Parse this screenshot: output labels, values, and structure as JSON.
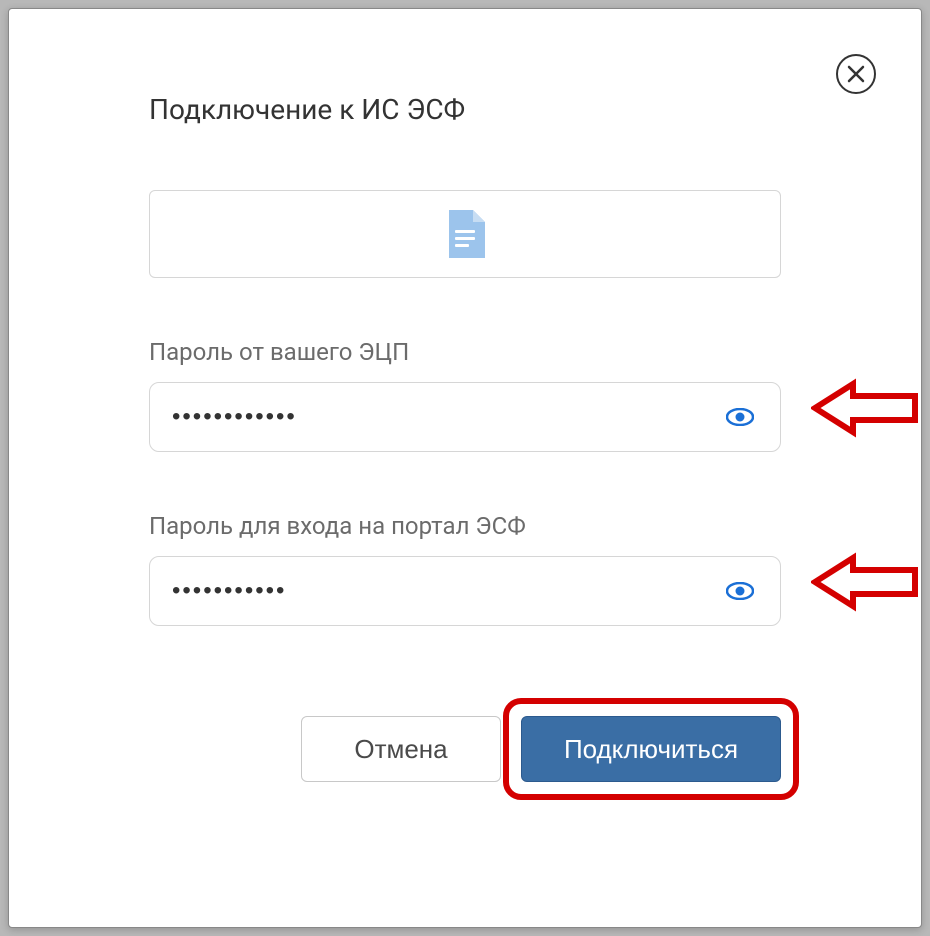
{
  "dialog": {
    "title": "Подключение к ИС ЭСФ",
    "file_icon": "document-icon"
  },
  "fields": {
    "ecp_password": {
      "label": "Пароль от вашего ЭЦП",
      "value": "••••••••••••"
    },
    "portal_password": {
      "label": "Пароль для входа на портал ЭСФ",
      "value": "•••••••••••"
    }
  },
  "buttons": {
    "cancel": "Отмена",
    "connect": "Подключиться"
  },
  "colors": {
    "primary": "#3a6ea5",
    "accent_blue": "#1a6fd6",
    "annotation_red": "#d40000"
  }
}
